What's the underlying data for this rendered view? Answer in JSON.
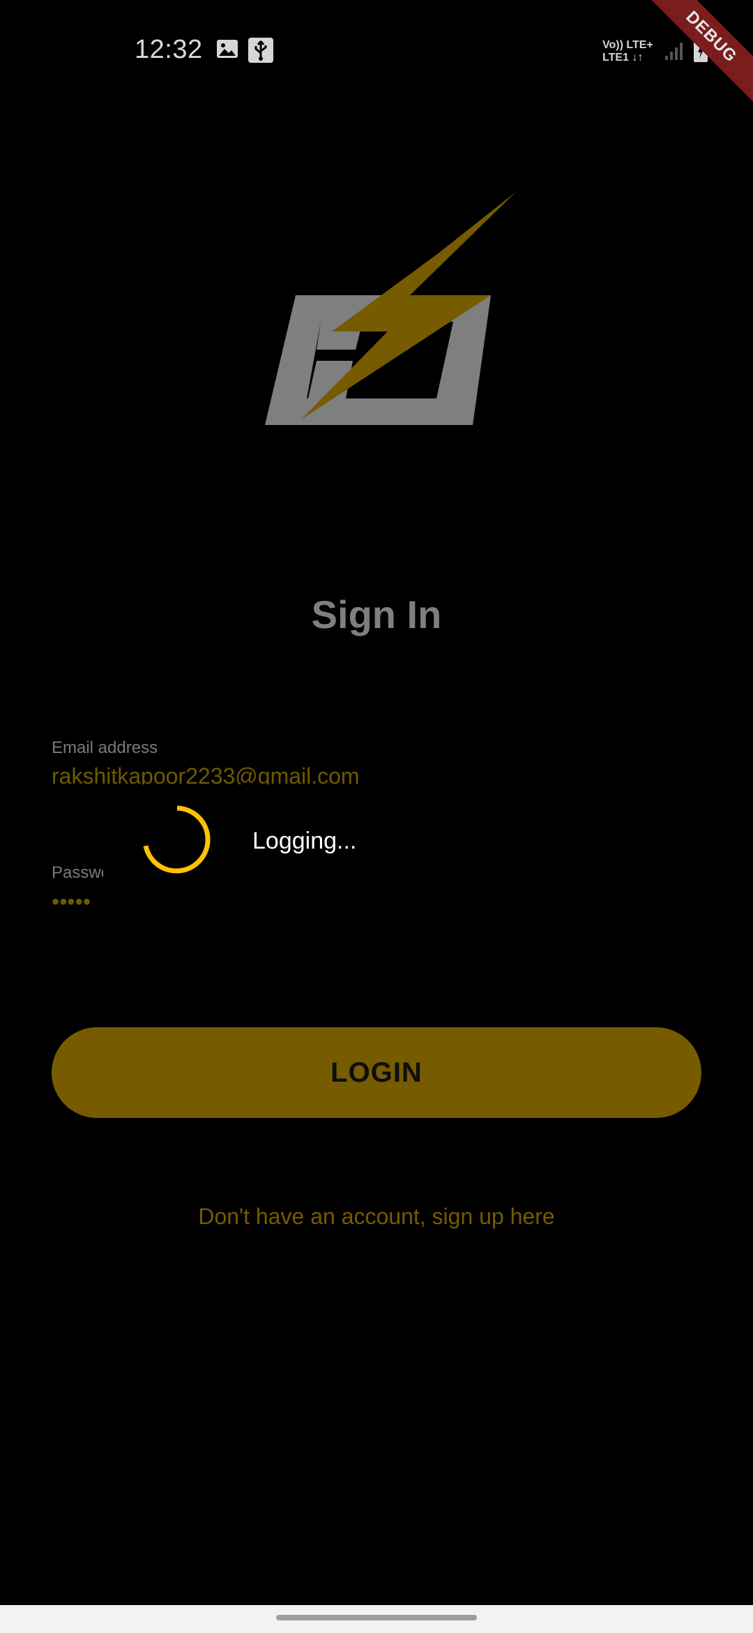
{
  "status_bar": {
    "time": "12:32",
    "network_line1": "Vo)) LTE+",
    "network_line2": "LTE1 ↓↑",
    "icons": [
      "image-icon",
      "usb-icon",
      "signal-icon",
      "battery-icon"
    ]
  },
  "debug_banner": "DEBUG",
  "logo": {
    "icon": "lightning-logo-icon"
  },
  "form": {
    "title": "Sign In",
    "email": {
      "label": "Email address",
      "value": "rakshitkapoor2233@gmail.com"
    },
    "password": {
      "label": "Password",
      "value": "•••••"
    },
    "login_label": "LOGIN",
    "signup_text": "Don't have an account, sign up here"
  },
  "loading": {
    "text": "Logging..."
  },
  "colors": {
    "background": "#000000",
    "accent": "#FFC107",
    "accent_dimmed": "#765B00",
    "logo_gray": "#7F7F7F"
  }
}
